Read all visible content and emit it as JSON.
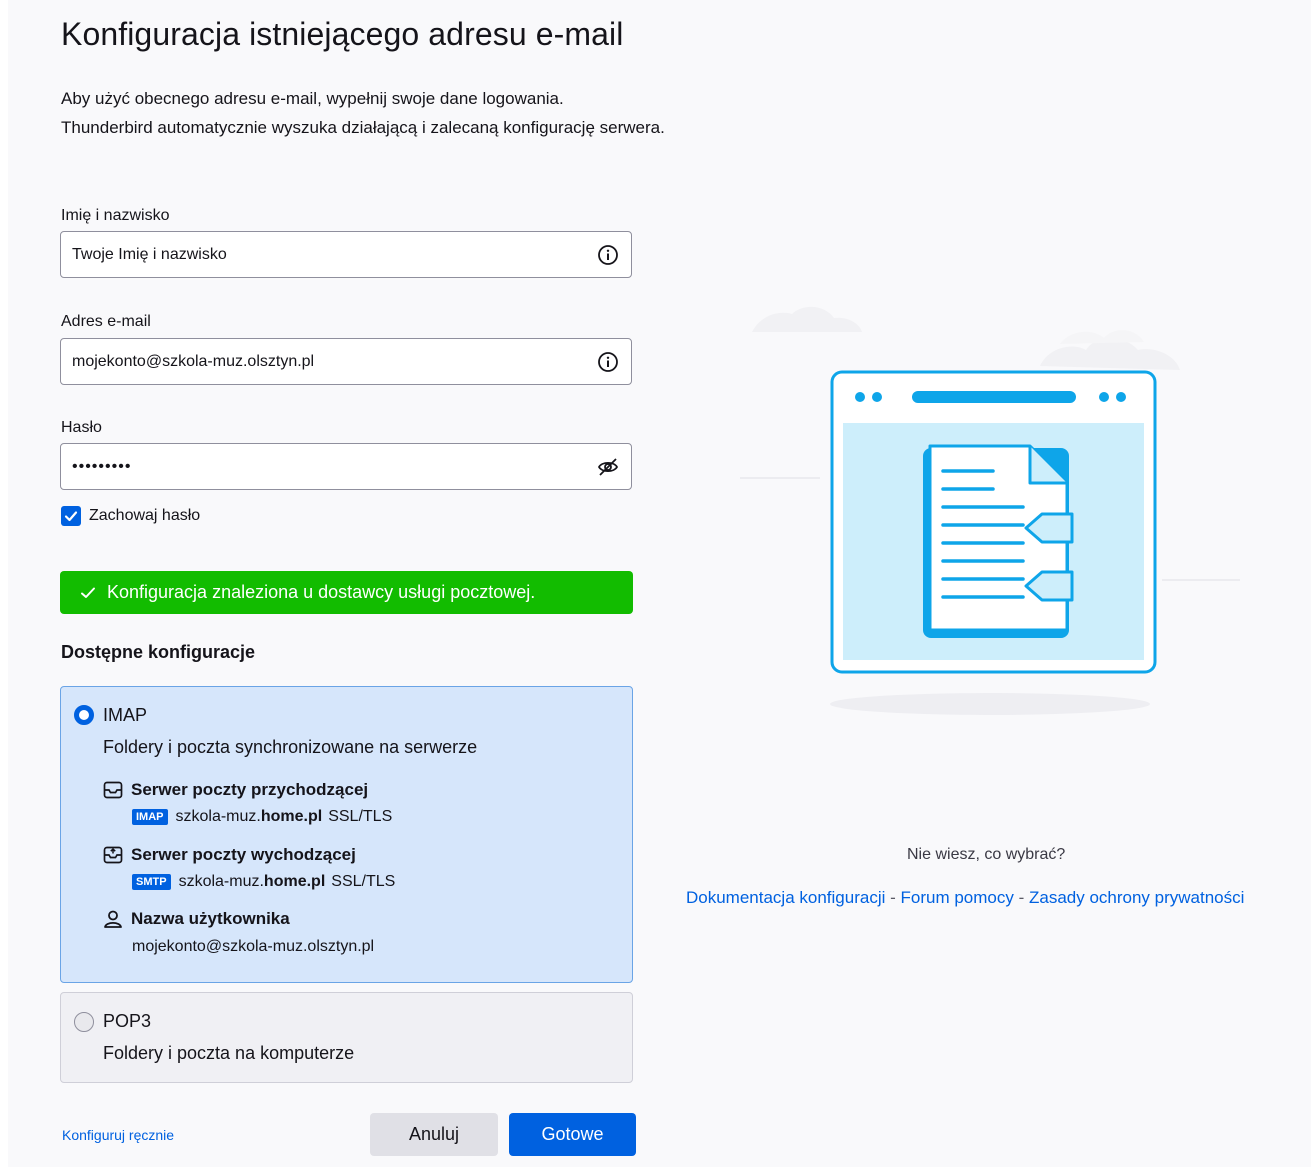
{
  "page": {
    "title": "Konfiguracja istniejącego adresu e-mail",
    "subtitle_line1": "Aby użyć obecnego adresu e-mail, wypełnij swoje dane logowania.",
    "subtitle_line2": "Thunderbird automatycznie wyszuka działającą i zalecaną konfigurację serwera."
  },
  "form": {
    "name_label": "Imię i nazwisko",
    "name_value": "Twoje Imię i nazwisko",
    "email_label": "Adres e-mail",
    "email_value": "mojekonto@szkola-muz.olsztyn.pl",
    "password_label": "Hasło",
    "password_value": "•••••••••",
    "remember_label": "Zachowaj hasło",
    "remember_checked": true
  },
  "status": {
    "message": "Konfiguracja znaleziona u dostawcy usługi pocztowej.",
    "color": "#12bc00"
  },
  "configs": {
    "heading": "Dostępne konfiguracje",
    "imap": {
      "name": "IMAP",
      "description": "Foldery i poczta synchronizowane na serwerze",
      "incoming_title": "Serwer poczty przychodzącej",
      "incoming_badge": "IMAP",
      "incoming_host_prefix": "szkola-muz.",
      "incoming_host_domain": "home.pl",
      "incoming_security": "SSL/TLS",
      "outgoing_title": "Serwer poczty wychodzącej",
      "outgoing_badge": "SMTP",
      "outgoing_host_prefix": "szkola-muz.",
      "outgoing_host_domain": "home.pl",
      "outgoing_security": "SSL/TLS",
      "username_title": "Nazwa użytkownika",
      "username_value": "mojekonto@szkola-muz.olsztyn.pl"
    },
    "pop3": {
      "name": "POP3",
      "description": "Foldery i poczta na komputerze"
    }
  },
  "actions": {
    "manual_config": "Konfiguruj ręcznie",
    "cancel": "Anuluj",
    "done": "Gotowe"
  },
  "help": {
    "question": "Nie wiesz, co wybrać?",
    "link_docs": "Dokumentacja konfiguracji",
    "link_forum": "Forum pomocy",
    "link_privacy": "Zasady ochrony prywatności",
    "separator": " - "
  },
  "colors": {
    "accent": "#0061e0",
    "selected_card": "#d6e6fb",
    "illustration_blue": "#0ea5e9"
  },
  "icons": {
    "name_info": "info-icon",
    "email_info": "info-icon",
    "password_toggle": "eye-slash-icon",
    "incoming": "inbox-icon",
    "outgoing": "outbox-icon",
    "user": "user-icon"
  }
}
